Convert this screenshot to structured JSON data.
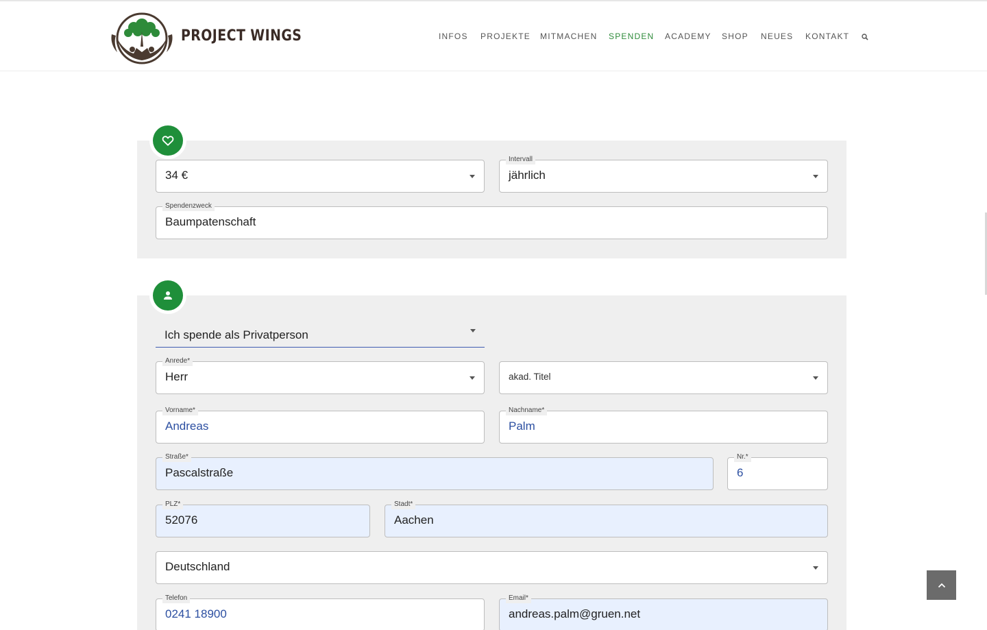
{
  "header": {
    "brand": "PROJECT WINGS",
    "nav": [
      "INFOS",
      "PROJEKTE",
      "MITMACHEN",
      "SPENDEN",
      "ACADEMY",
      "SHOP",
      "NEUES",
      "KONTAKT"
    ],
    "active_nav": "SPENDEN"
  },
  "donation": {
    "amount": "34 €",
    "interval_label": "Intervall",
    "interval_value": "jährlich",
    "purpose_label": "Spendenzweck",
    "purpose_value": "Baumpatenschaft"
  },
  "donor": {
    "type_value": "Ich spende als Privatperson",
    "salutation_label": "Anrede*",
    "salutation_value": "Herr",
    "title_placeholder": "akad. Titel",
    "firstname_label": "Vorname*",
    "firstname_value": "Andreas",
    "lastname_label": "Nachname*",
    "lastname_value": "Palm",
    "street_label": "Straße*",
    "street_value": "Pascalstraße",
    "number_label": "Nr.*",
    "number_value": "6",
    "zip_label": "PLZ*",
    "zip_value": "52076",
    "city_label": "Stadt*",
    "city_value": "Aachen",
    "country_value": "Deutschland",
    "phone_label": "Telefon",
    "phone_value": "0241 18900",
    "email_label": "Email*",
    "email_value": "andreas.palm@gruen.net"
  },
  "colors": {
    "accent_green": "#1f8f3a",
    "active_nav": "#2e8b3a",
    "autofill_bg": "#e8f0fe",
    "link_blue": "#2c4fa1"
  },
  "icons": [
    "heart-icon",
    "user-icon",
    "search-icon",
    "chevron-up-icon",
    "tree-logo-icon"
  ]
}
